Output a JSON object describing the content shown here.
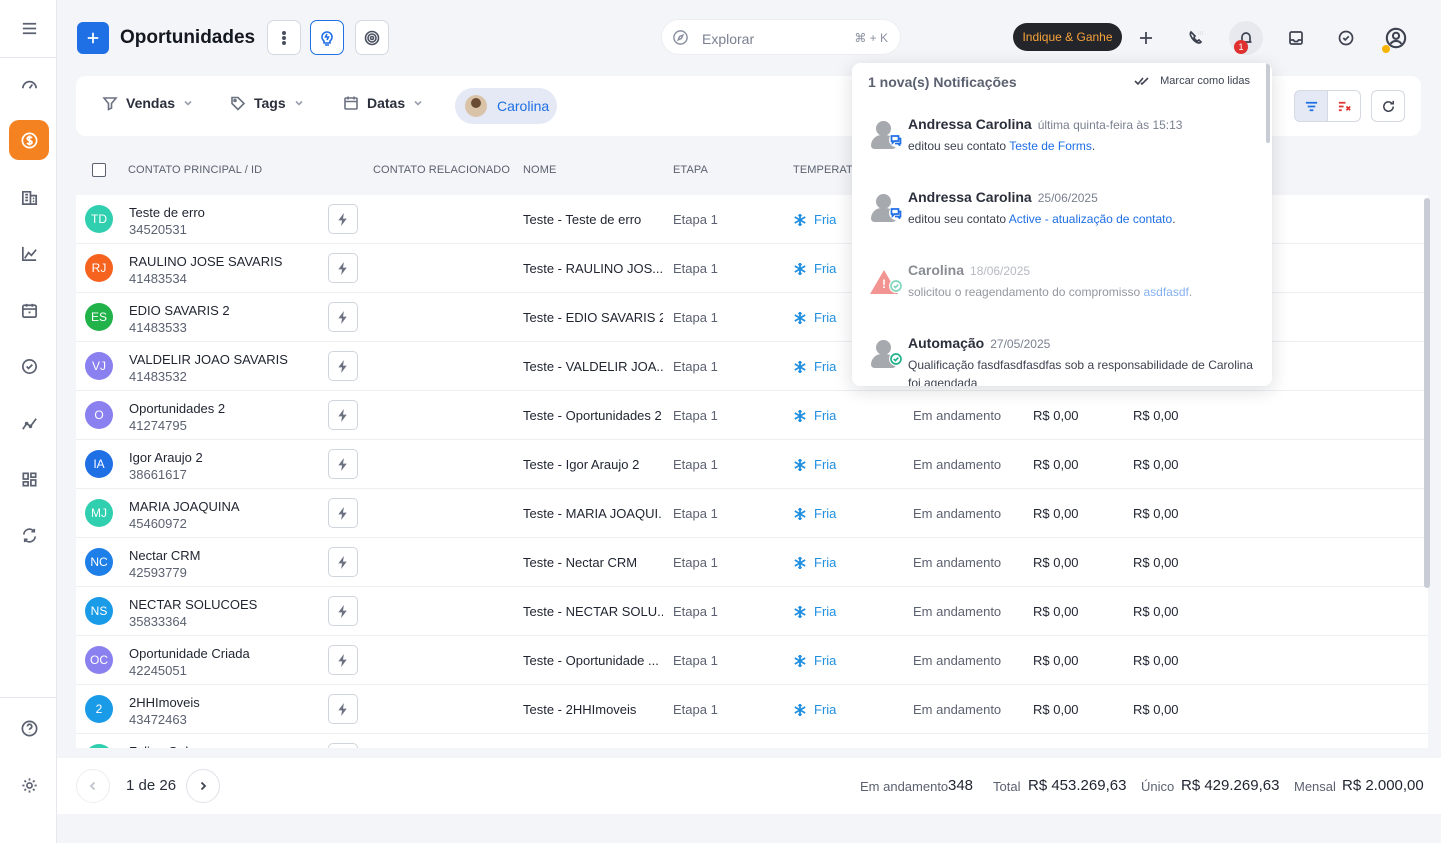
{
  "header": {
    "title": "Oportunidades",
    "search_placeholder": "Explorar",
    "search_shortcut": "⌘ + K",
    "indique_label": "Indique & Ganhe",
    "notif_badge": "1"
  },
  "filters": {
    "vendas": "Vendas",
    "tags": "Tags",
    "datas": "Datas",
    "user_chip": "Carolina"
  },
  "columns": {
    "contato": "CONTATO PRINCIPAL / ID",
    "relacionado": "CONTATO RELACIONADO",
    "nome": "NOME",
    "etapa": "ETAPA",
    "temperatura": "TEMPERATU"
  },
  "rows": [
    {
      "initials": "TD",
      "color": "#2fcfb0",
      "name": "Teste de erro",
      "id": "34520531",
      "opp": "Teste - Teste de erro",
      "etapa": "Etapa 1",
      "temp": "Fria",
      "status": "",
      "v1": "",
      "v2": ""
    },
    {
      "initials": "RJ",
      "color": "#f5631f",
      "name": "RAULINO JOSE SAVARIS",
      "id": "41483534",
      "opp": "Teste - RAULINO JOS...",
      "etapa": "Etapa 1",
      "temp": "Fria",
      "status": "",
      "v1": "",
      "v2": ""
    },
    {
      "initials": "ES",
      "color": "#21b34a",
      "name": "EDIO SAVARIS 2",
      "id": "41483533",
      "opp": "Teste - EDIO SAVARIS 2",
      "etapa": "Etapa 1",
      "temp": "Fria",
      "status": "",
      "v1": "",
      "v2": ""
    },
    {
      "initials": "VJ",
      "color": "#8b80ef",
      "name": "VALDELIR JOAO SAVARIS",
      "id": "41483532",
      "opp": "Teste - VALDELIR JOA...",
      "etapa": "Etapa 1",
      "temp": "Fria",
      "status": "",
      "v1": "",
      "v2": ""
    },
    {
      "initials": "O",
      "color": "#8b80ef",
      "name": "Oportunidades 2",
      "id": "41274795",
      "opp": "Teste - Oportunidades 2",
      "etapa": "Etapa 1",
      "temp": "Fria",
      "status": "Em andamento",
      "v1": "R$ 0,00",
      "v2": "R$ 0,00"
    },
    {
      "initials": "IA",
      "color": "#1f6fe5",
      "name": "Igor Araujo 2",
      "id": "38661617",
      "opp": "Teste - Igor Araujo 2",
      "etapa": "Etapa 1",
      "temp": "Fria",
      "status": "Em andamento",
      "v1": "R$ 0,00",
      "v2": "R$ 0,00"
    },
    {
      "initials": "MJ",
      "color": "#2fcfb0",
      "name": "MARIA JOAQUINA",
      "id": "45460972",
      "opp": "Teste - MARIA JOAQUI...",
      "etapa": "Etapa 1",
      "temp": "Fria",
      "status": "Em andamento",
      "v1": "R$ 0,00",
      "v2": "R$ 0,00"
    },
    {
      "initials": "NC",
      "color": "#1f7fe8",
      "name": "Nectar CRM",
      "id": "42593779",
      "opp": "Teste - Nectar CRM",
      "etapa": "Etapa 1",
      "temp": "Fria",
      "status": "Em andamento",
      "v1": "R$ 0,00",
      "v2": "R$ 0,00"
    },
    {
      "initials": "NS",
      "color": "#1a9be8",
      "name": "NECTAR SOLUCOES",
      "id": "35833364",
      "opp": "Teste - NECTAR SOLU...",
      "etapa": "Etapa 1",
      "temp": "Fria",
      "status": "Em andamento",
      "v1": "R$ 0,00",
      "v2": "R$ 0,00"
    },
    {
      "initials": "OC",
      "color": "#8b80ef",
      "name": "Oportunidade Criada",
      "id": "42245051",
      "opp": "Teste - Oportunidade ...",
      "etapa": "Etapa 1",
      "temp": "Fria",
      "status": "Em andamento",
      "v1": "R$ 0,00",
      "v2": "R$ 0,00"
    },
    {
      "initials": "2",
      "color": "#1a9be8",
      "name": "2HHImoveis",
      "id": "43472463",
      "opp": "Teste - 2HHImoveis",
      "etapa": "Etapa 1",
      "temp": "Fria",
      "status": "Em andamento",
      "v1": "R$ 0,00",
      "v2": "R$ 0,00"
    },
    {
      "initials": "",
      "color": "#2fcfb0",
      "name": "Felipe Gulnar",
      "id": "",
      "opp": "",
      "etapa": "",
      "temp": "",
      "status": "",
      "v1": "",
      "v2": ""
    }
  ],
  "footer": {
    "page": "1 de 26",
    "em_andamento_label": "Em andamento",
    "em_andamento_value": "348",
    "total_label": "Total",
    "total_value": "R$ 453.269,63",
    "unico_label": "Único",
    "unico_value": "R$ 429.269,63",
    "mensal_label": "Mensal",
    "mensal_value": "R$ 2.000,00"
  },
  "notifications": {
    "title": "1 nova(s) Notificações",
    "mark_read": "Marcar como lidas",
    "items": [
      {
        "kind": "user",
        "sub": "chat",
        "name": "Andressa Carolina",
        "time": "última quinta-feira às 15:13",
        "text": "editou seu contato ",
        "link": "Teste de Forms",
        "suffix": ".",
        "dim": false
      },
      {
        "kind": "user",
        "sub": "chat",
        "name": "Andressa Carolina",
        "time": "25/06/2025",
        "text": "editou seu contato ",
        "link": "Active - atualização de contato",
        "suffix": ".",
        "dim": false
      },
      {
        "kind": "warn",
        "sub": "check",
        "name": "Carolina",
        "time": "18/06/2025",
        "text": "solicitou o reagendamento do compromisso ",
        "link": "asdfasdf",
        "suffix": ".",
        "dim": true
      },
      {
        "kind": "user",
        "sub": "check",
        "name": "Automação",
        "time": "27/05/2025",
        "text": "Qualificação fasdfasdfasdfas sob a responsabilidade de Carolina foi agendada",
        "link": "",
        "suffix": "",
        "dim": false
      }
    ]
  },
  "colors": {
    "accent": "#1f6fe5",
    "active_nav": "#f58220",
    "cold": "#1f8fe0"
  }
}
